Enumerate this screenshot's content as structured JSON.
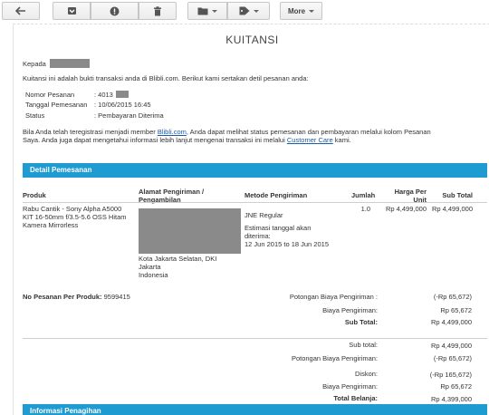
{
  "toolbar": {
    "back_icon": "arrow-left-icon",
    "archive_icon": "archive-icon",
    "spam_icon": "report-spam-icon",
    "delete_icon": "trash-icon",
    "folder_icon": "folder-icon",
    "label_icon": "tag-icon",
    "more_label": "More"
  },
  "email": {
    "title": "KUITANSI",
    "greeting": "Kepada",
    "intro": "Kuitansi ini adalah bukti transaksi anda di Blibli.com. Berikut kami sertakan detil pesanan anda:",
    "order": {
      "number_label": "Nomor Pesanan",
      "number_value": ": 4013",
      "date_label": "Tanggal Pemesanan",
      "date_value": ": 10/06/2015 16:45",
      "status_label": "Status",
      "status_value": ": Pembayaran Diterima"
    },
    "notice": {
      "line1_a": "Bila Anda telah teregistrasi menjadi member ",
      "line1_link": "Blibli.com",
      "line1_b": ", Anda dapat melihat status pemesanan dan pembayaran melalui kolom Pesanan",
      "line2_a": "Saya. Anda juga dapat mengetahui informasi lebih lanjut mengenai transaksi ini melalui ",
      "line2_link": "Customer Care",
      "line2_b": " kami."
    },
    "section_detail": "Detail Pemesanan",
    "table": {
      "headers": {
        "produk": "Produk",
        "alamat_1": "Alamat Pengiriman /",
        "alamat_2": "Pengambilan",
        "metode": "Metode Pengiriman",
        "jumlah": "Jumlah",
        "harga_1": "Harga Per",
        "harga_2": "Unit",
        "subtotal": "Sub Total"
      },
      "row": {
        "product_1": "Rabu Cantik - Sony Alpha A5000",
        "product_2": "KIT 16-50mm f/3.5-5.6 OSS Hitam",
        "product_3": "Kamera Mirrorless",
        "address_1": "Kota Jakarta Selatan, DKI",
        "address_2": "Jakarta",
        "address_3": "Indonesia",
        "method": "JNE Regular",
        "estimate_1": "Estimasi tanggal akan",
        "estimate_2": "diterima:",
        "estimate_3": "12 Jun 2015 to 18 Jun 2015",
        "qty": "1.0",
        "unit_price": "Rp 4,499,000",
        "subtotal": "Rp 4,499,000"
      }
    },
    "per_product": {
      "label": "No Pesanan Per Produk:",
      "value": "9599415",
      "discount_label": "Potongan Biaya Pengiriman :",
      "discount_value": "(-Rp 65,672)",
      "shipping_label": "Biaya Pengiriman:",
      "shipping_value": "Rp 65,672",
      "subtotal_label": "Sub Total:",
      "subtotal_value": "Rp 4,499,000"
    },
    "totals": {
      "subtotal_label": "Sub total:",
      "subtotal_value": "Rp 4,499,000",
      "ship_discount_label": "Potongan Biaya Pengiriman:",
      "ship_discount_value": "(-Rp 65,672)",
      "discount_label": "Diskon:",
      "discount_value": "(-Rp 165,672)",
      "shipping_label": "Biaya Pengiriman:",
      "shipping_value": "Rp 65,672",
      "total_label": "Total Belanja:",
      "total_value": "Rp 4,399,000"
    },
    "section_info": "Informasi Penagihan"
  },
  "colors": {
    "accent_bar": "#1e9bd0",
    "link": "#1a5ca8",
    "redaction": "#8a8a8a"
  }
}
